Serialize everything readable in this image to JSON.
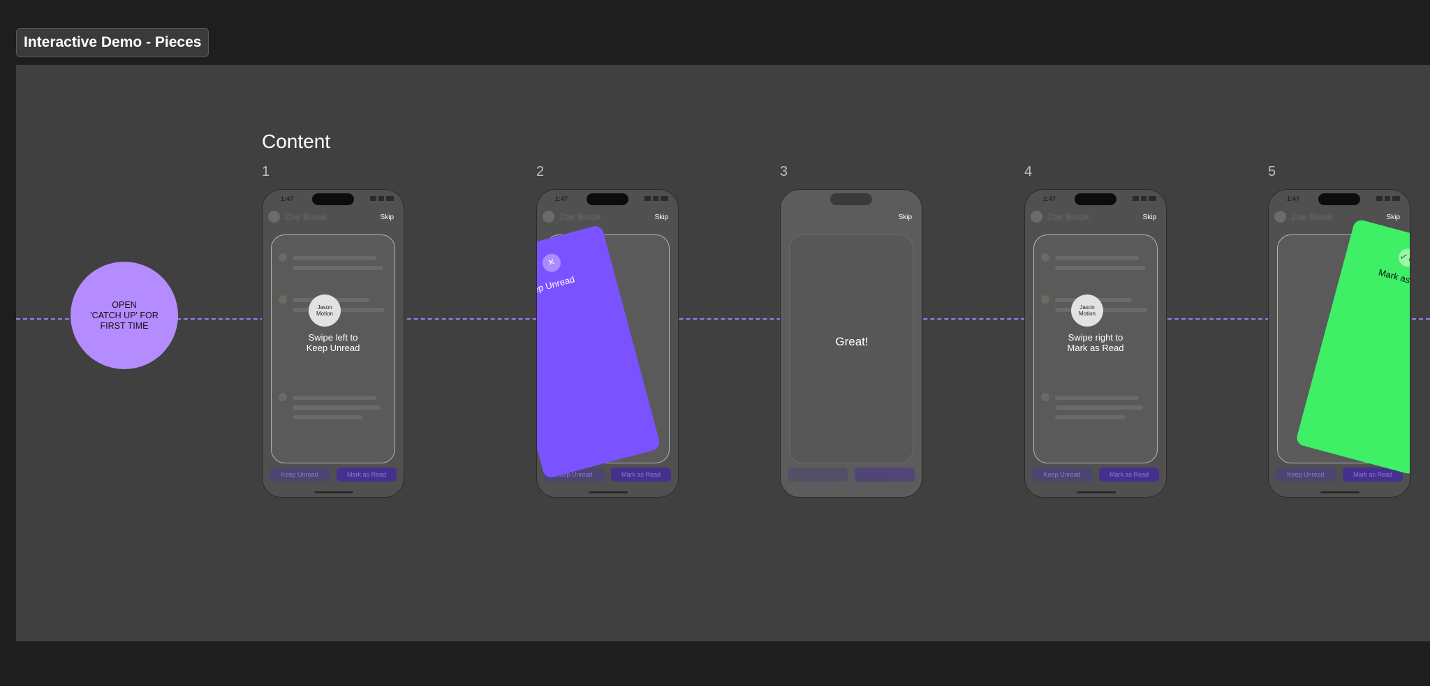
{
  "frame": {
    "title": "Interactive Demo - Pieces"
  },
  "start_node": {
    "label": "OPEN\n'CATCH UP' FOR\nFIRST TIME"
  },
  "section": {
    "title": "Content"
  },
  "steps": [
    {
      "num": "1",
      "overlay": "Swipe left to\nKeep Unread",
      "avatar": "Jason\nMotion"
    },
    {
      "num": "2",
      "card_label": "Keep Unread",
      "card_icon": "×"
    },
    {
      "num": "3",
      "overlay": "Great!"
    },
    {
      "num": "4",
      "overlay": "Swipe right to\nMark as Read",
      "avatar": "Jason\nMotion"
    },
    {
      "num": "5",
      "card_label": "Mark as read",
      "card_icon": "✓✓"
    }
  ],
  "phone": {
    "time": "1:47",
    "skip": "Skip",
    "sender": "Zoe Brook",
    "keep_unread": "Keep Unread",
    "mark_as_read": "Mark as Read"
  },
  "colors": {
    "purple_card": "#7b52ff",
    "green_card": "#3ff067",
    "start_node": "#b48cff",
    "flow_line": "#a07ef0"
  },
  "icons": [
    "close-icon",
    "double-check-icon"
  ]
}
